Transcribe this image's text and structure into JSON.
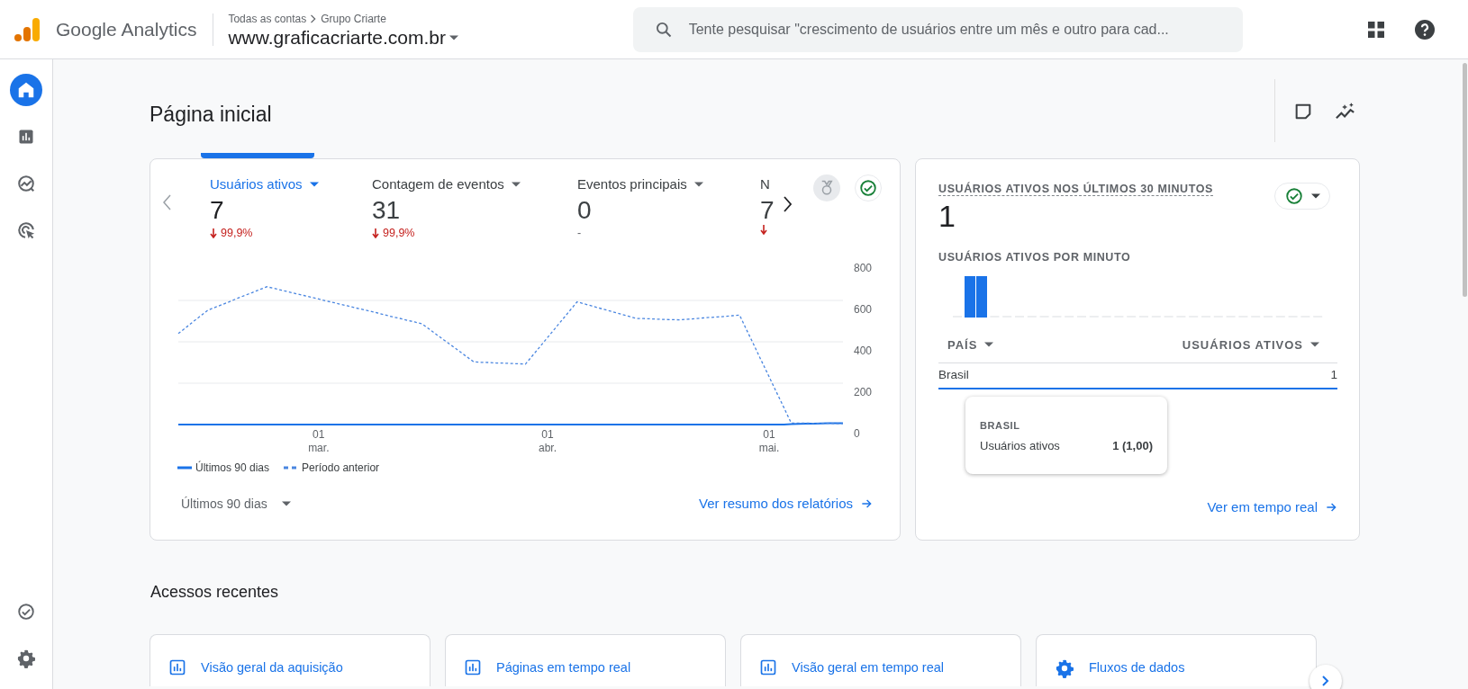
{
  "header": {
    "product_name": "Google Analytics",
    "breadcrumb": [
      "Todas as contas",
      "Grupo Criarte"
    ],
    "property": "www.graficacriarte.com.br",
    "search": {
      "placeholder": "Tente pesquisar \"crescimento de usuários entre um mês e outro para cad..."
    }
  },
  "sidebar": {
    "items": [
      {
        "kind": "home",
        "selected": true
      },
      {
        "kind": "reports",
        "selected": false
      },
      {
        "kind": "explore",
        "selected": false
      },
      {
        "kind": "advertising",
        "selected": false
      }
    ],
    "bottom_items": [
      {
        "kind": "check"
      },
      {
        "kind": "settings"
      }
    ]
  },
  "page": {
    "title": "Página inicial"
  },
  "overview_card": {
    "metrics": [
      {
        "label": "Usuários ativos",
        "value": "7",
        "change": "99,9%",
        "decrease": true,
        "selected": true
      },
      {
        "label": "Contagem de eventos",
        "value": "31",
        "change": "99,9%",
        "decrease": true,
        "selected": false
      },
      {
        "label": "Eventos principais",
        "value": "0",
        "change": "-",
        "decrease": false,
        "selected": false
      },
      {
        "label": "N",
        "value": "7",
        "decrease": true,
        "selected": false
      }
    ],
    "chart_data": {
      "type": "line",
      "categories": [
        null,
        null,
        null,
        null,
        null,
        null,
        null,
        null,
        null,
        null,
        null,
        null,
        null,
        null,
        null,
        null,
        null,
        null,
        null,
        "01 mar.",
        null,
        null,
        null,
        null,
        null,
        null,
        null,
        null,
        null,
        null,
        null,
        null,
        null,
        null,
        null,
        null,
        null,
        null,
        null,
        null,
        null,
        null,
        null,
        null,
        null,
        null,
        null,
        null,
        null,
        null,
        "01 abr.",
        null,
        null,
        null,
        null,
        null,
        null,
        null,
        null,
        null,
        null,
        null,
        null,
        null,
        null,
        null,
        null,
        null,
        null,
        null,
        null,
        null,
        null,
        null,
        null,
        null,
        null,
        null,
        null,
        null,
        "01 mai.",
        null,
        null,
        null,
        null,
        null,
        null,
        null,
        null,
        null,
        null
      ],
      "ylim": [
        0,
        800
      ],
      "yticks": [
        0,
        200,
        400,
        600,
        800
      ],
      "grid": true,
      "series": [
        {
          "name": "Últimos 90 dias",
          "color": "#1a73e8",
          "line_style": "solid",
          "values": [
            0,
            0,
            0,
            0,
            0,
            0,
            0,
            0,
            0,
            0,
            0,
            0,
            0,
            0,
            0,
            0,
            0,
            0,
            0,
            0,
            0,
            0,
            0,
            0,
            0,
            0,
            0,
            0,
            0,
            0,
            0,
            0,
            0,
            0,
            0,
            0,
            0,
            0,
            0,
            0,
            0,
            0,
            0,
            0,
            0,
            0,
            0,
            0,
            0,
            0,
            0,
            0,
            0,
            0,
            0,
            0,
            0,
            0,
            0,
            0,
            0,
            0,
            0,
            0,
            0,
            0,
            0,
            0,
            0,
            0,
            0,
            0,
            0,
            0,
            0,
            0,
            0,
            0,
            0,
            0,
            0,
            0,
            0,
            2,
            3,
            4,
            4,
            5,
            6,
            6,
            7
          ]
        },
        {
          "name": "Período anterior",
          "color": "#4a86e0",
          "line_style": "dashed",
          "values": [
            440,
            468,
            497,
            525,
            553,
            567,
            581,
            595,
            610,
            624,
            638,
            652,
            666,
            658,
            649,
            641,
            632,
            624,
            615,
            607,
            598,
            590,
            581,
            573,
            564,
            556,
            548,
            539,
            530,
            521,
            513,
            504,
            496,
            487,
            461,
            434,
            408,
            382,
            356,
            329,
            303,
            301,
            300,
            298,
            297,
            295,
            294,
            292,
            335,
            378,
            421,
            464,
            507,
            550,
            593,
            583,
            573,
            563,
            553,
            543,
            533,
            523,
            513,
            512,
            511,
            509,
            508,
            507,
            506,
            509,
            512,
            515,
            518,
            520,
            523,
            526,
            529,
            454,
            380,
            305,
            231,
            156,
            82,
            7,
            7,
            7,
            6,
            6,
            6,
            5,
            5
          ]
        }
      ]
    },
    "date_range": "Últimos 90 dias",
    "link": "Ver resumo dos relatórios"
  },
  "realtime_card": {
    "title": "USUÁRIOS ATIVOS NOS ÚLTIMOS 30 MINUTOS",
    "value": "1",
    "subtitle": "USUÁRIOS ATIVOS POR MINUTO",
    "table": {
      "columns": [
        "PAÍS",
        "USUÁRIOS ATIVOS"
      ],
      "rows": [
        {
          "cells": [
            "Brasil",
            "1"
          ],
          "selected": true
        }
      ]
    },
    "tooltip": {
      "title": "BRASIL",
      "label": "Usuários ativos",
      "value": "1 (1,00)"
    },
    "link": "Ver em tempo real"
  },
  "recent": {
    "title": "Acessos recentes",
    "items": [
      {
        "kind": "report",
        "label": "Visão geral da aquisição"
      },
      {
        "kind": "report",
        "label": "Páginas em tempo real"
      },
      {
        "kind": "report",
        "label": "Visão geral em tempo real"
      },
      {
        "kind": "settings",
        "label": "Fluxos de dados"
      }
    ]
  }
}
